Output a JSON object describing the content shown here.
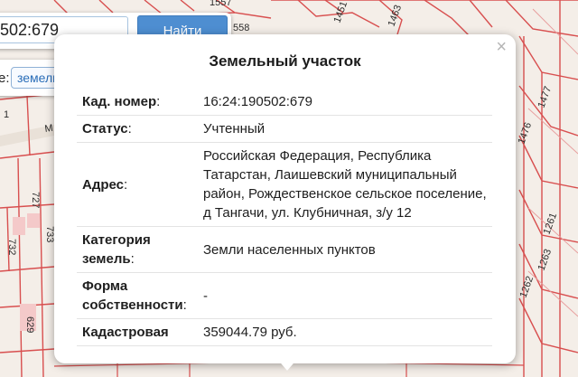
{
  "search": {
    "value": "502:679",
    "button_label": "Найти"
  },
  "type_filter": {
    "label_fragment": "е:",
    "selected": "земельный участок"
  },
  "popup": {
    "title": "Земельный участок",
    "close_symbol": "×",
    "rows": [
      {
        "key": "Кад. номер",
        "colon": ":",
        "value": "16:24:190502:679"
      },
      {
        "key": "Статус",
        "colon": ":",
        "value": "Учтенный"
      },
      {
        "key": "Адрес",
        "colon": ":",
        "value": "Российская Федерация, Республика Татарстан, Лаишевский муниципальный район, Рождественское сельское поселение, д Тангачи, ул. Клубничная, з/у 12"
      },
      {
        "key": "Категория земель",
        "colon": ":",
        "value": "Земли населенных пунктов"
      },
      {
        "key": "Форма собственности",
        "colon": ":",
        "value": "-"
      },
      {
        "key": "Кадастровая",
        "colon": "",
        "value": "359044.79 руб."
      }
    ]
  },
  "map": {
    "parcel_labels": [
      "1557",
      "1451",
      "1463",
      "1477",
      "1476",
      "1263",
      "1262",
      "1261",
      "558",
      "727",
      "733",
      "732",
      "629",
      "1",
      "M"
    ],
    "colors": {
      "background": "#f2ece6",
      "parcel_line": "#d84f4f",
      "parcel_fill": "#f7dede",
      "accent": "#4e8ed1"
    }
  }
}
